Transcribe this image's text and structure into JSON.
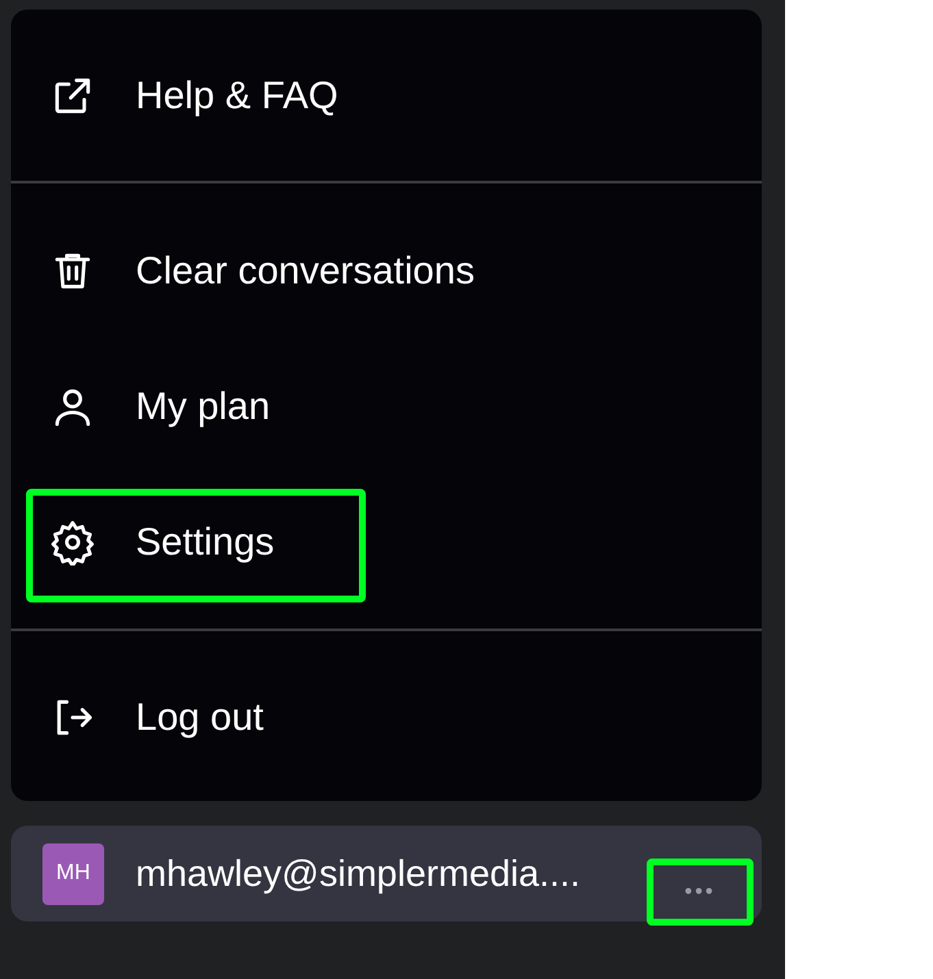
{
  "menu": {
    "sections": [
      {
        "items": [
          {
            "kind": "external-link",
            "label": "Help & FAQ",
            "highlighted": false
          }
        ]
      },
      {
        "items": [
          {
            "kind": "trash",
            "label": "Clear conversations",
            "highlighted": false
          },
          {
            "kind": "user",
            "label": "My plan",
            "highlighted": false
          },
          {
            "kind": "gear",
            "label": "Settings",
            "highlighted": true
          }
        ]
      },
      {
        "items": [
          {
            "kind": "logout",
            "label": "Log out",
            "highlighted": false
          }
        ]
      }
    ]
  },
  "account": {
    "initials": "MH",
    "email": "mhawley@simplermedia....",
    "more_button": {
      "label": "•••",
      "highlighted": true
    }
  }
}
